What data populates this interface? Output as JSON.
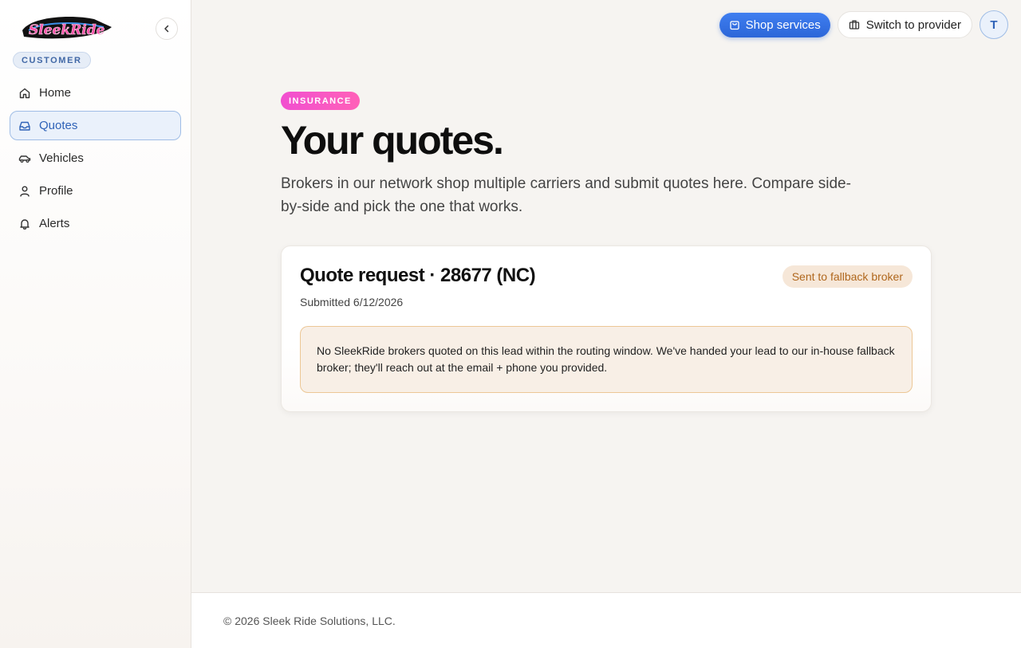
{
  "brand": {
    "logo_text": "SleekRide",
    "role_badge": "CUSTOMER"
  },
  "sidebar": {
    "items": [
      {
        "label": "Home",
        "icon": "home-icon",
        "active": false
      },
      {
        "label": "Quotes",
        "icon": "inbox-icon",
        "active": true
      },
      {
        "label": "Vehicles",
        "icon": "car-icon",
        "active": false
      },
      {
        "label": "Profile",
        "icon": "user-icon",
        "active": false
      },
      {
        "label": "Alerts",
        "icon": "bell-icon",
        "active": false
      }
    ]
  },
  "header": {
    "shop_label": "Shop services",
    "switch_label": "Switch to provider",
    "avatar_initial": "T"
  },
  "main": {
    "tag": "INSURANCE",
    "title": "Your quotes.",
    "lead": "Brokers in our network shop multiple carriers and submit quotes here. Compare side-by-side and pick the one that works."
  },
  "quote": {
    "title": "Quote request · 28677 (NC)",
    "submitted": "Submitted 6/12/2026",
    "status": "Sent to fallback broker",
    "notice": "No SleekRide brokers quoted on this lead within the routing window. We've handed your lead to our in-house fallback broker; they'll reach out at the email + phone you provided."
  },
  "footer": {
    "copyright": "© 2026 Sleek Ride Solutions, LLC."
  },
  "colors": {
    "accent": "#2f63b8",
    "primary_button": "#3072e4",
    "tag": "#f14fd0",
    "status_bg": "#f6e7d8",
    "status_text": "#b0671d"
  }
}
